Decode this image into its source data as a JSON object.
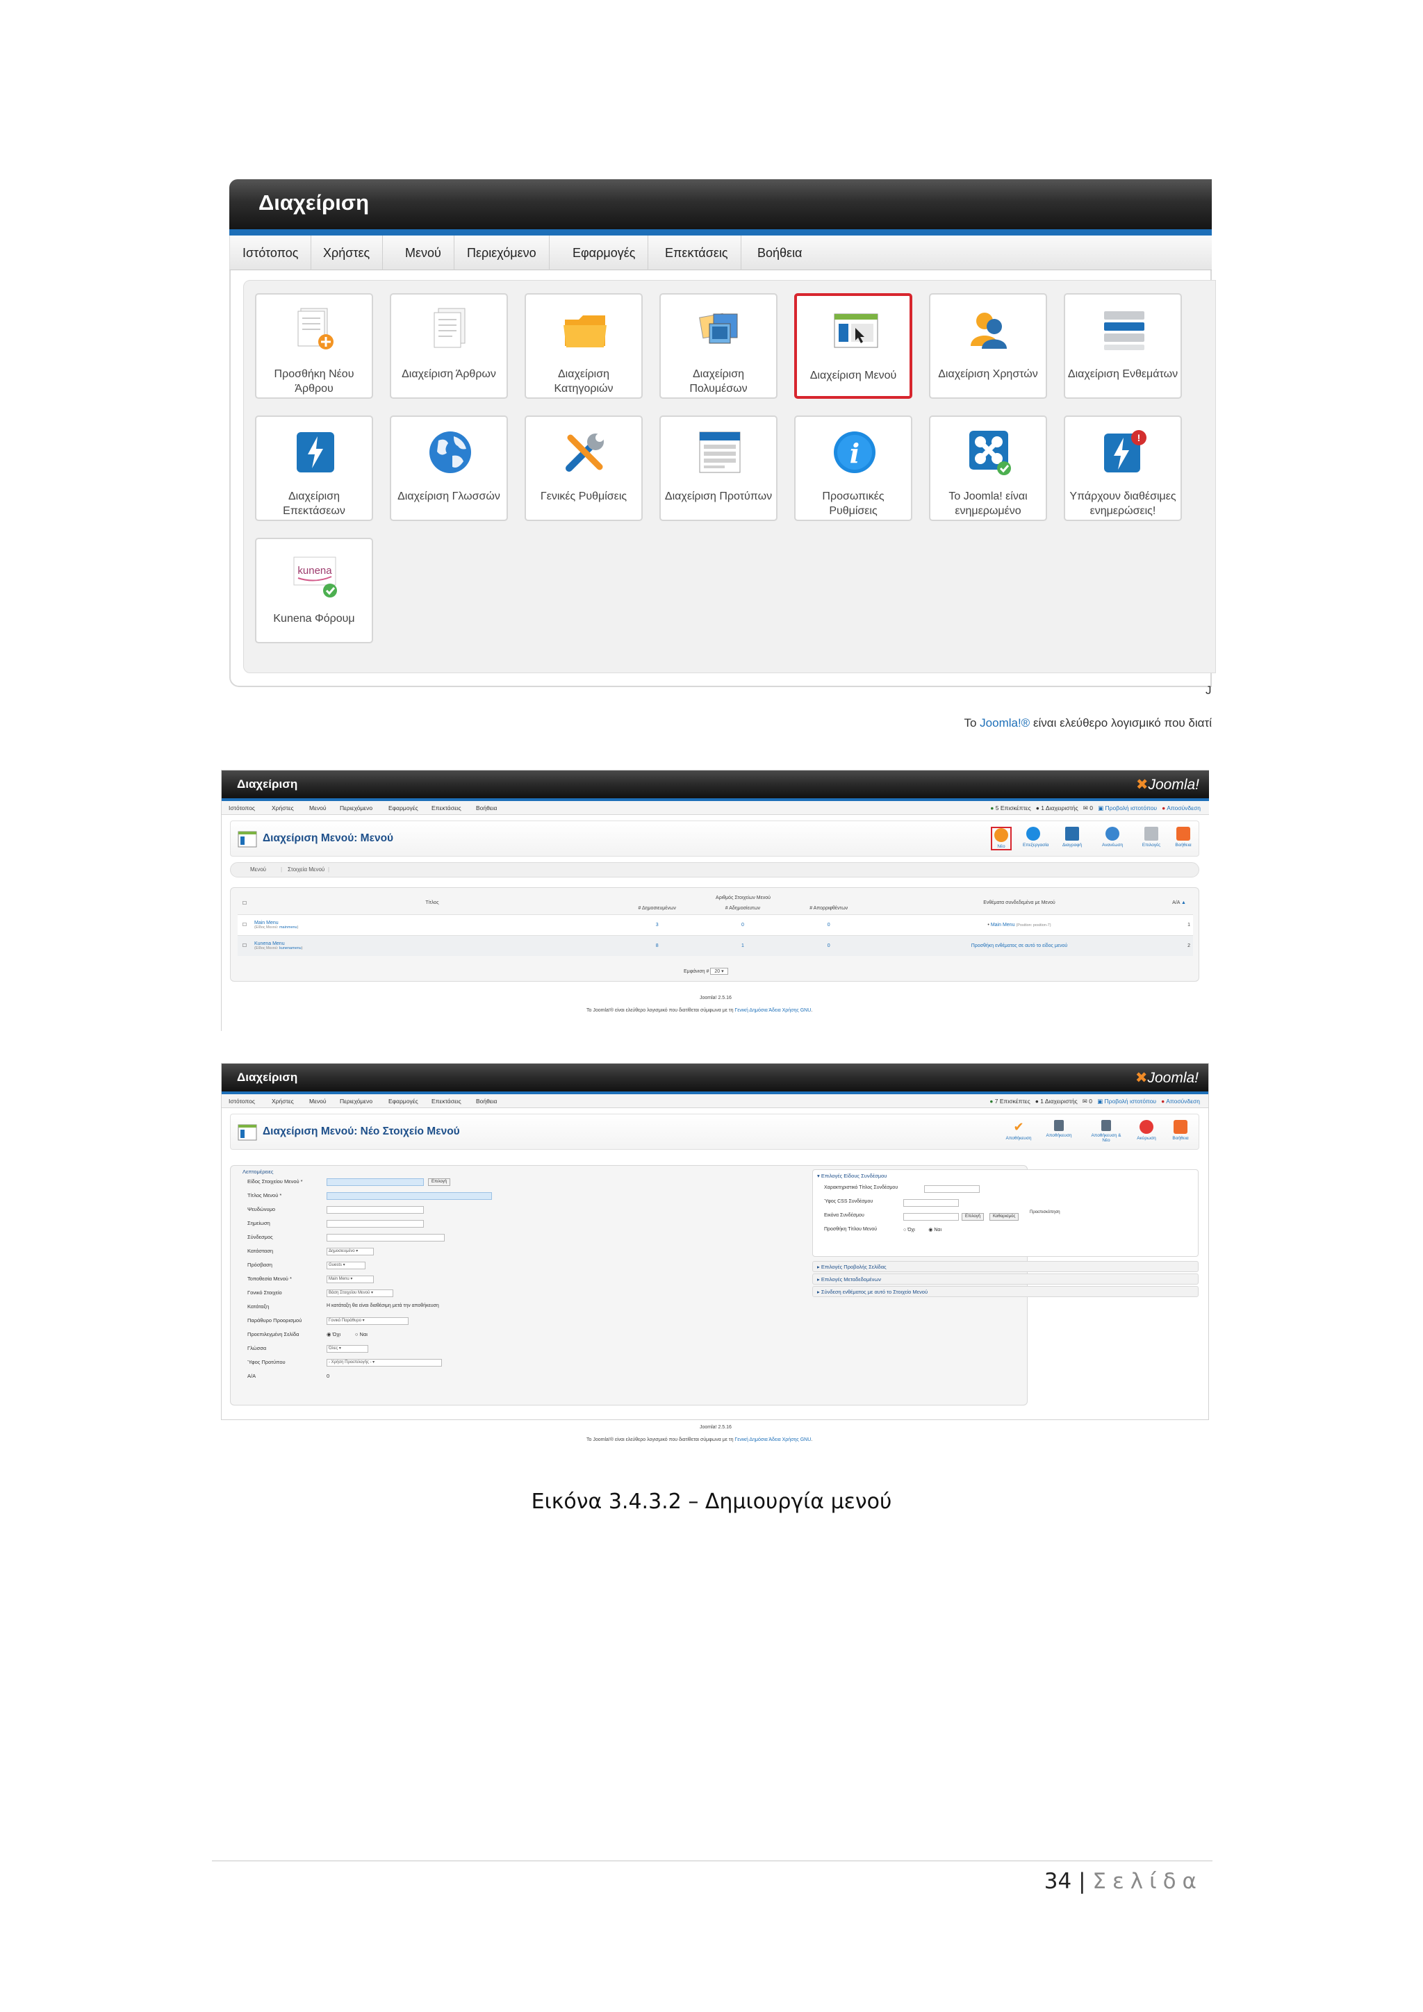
{
  "shot1": {
    "header_title": "Διαχείριση",
    "menu": [
      "Ιστότοπος",
      "Χρήστες",
      "Μενού",
      "Περιεχόμενο",
      "Εφαρμογές",
      "Επεκτάσεις",
      "Βοήθεια"
    ],
    "icons": [
      {
        "label": "Προσθήκη Νέου\nΆρθρου",
        "icon": "add-article-icon"
      },
      {
        "label": "Διαχείριση Άρθρων",
        "icon": "articles-icon"
      },
      {
        "label": "Διαχείριση\nΚατηγοριών",
        "icon": "folder-icon"
      },
      {
        "label": "Διαχείριση\nΠολυμέσων",
        "icon": "media-icon"
      },
      {
        "label": "Διαχείριση Μενού",
        "icon": "menu-icon",
        "highlighted": true
      },
      {
        "label": "Διαχείριση Χρηστών",
        "icon": "users-icon"
      },
      {
        "label": "Διαχείριση Ενθεμάτων",
        "icon": "modules-icon"
      },
      {
        "label": "Διαχείριση\nΕπεκτάσεων",
        "icon": "extensions-icon"
      },
      {
        "label": "Διαχείριση Γλωσσών",
        "icon": "globe-icon"
      },
      {
        "label": "Γενικές Ρυθμίσεις",
        "icon": "tools-icon"
      },
      {
        "label": "Διαχείριση Προτύπων",
        "icon": "template-icon"
      },
      {
        "label": "Προσωπικές\nΡυθμίσεις",
        "icon": "info-icon"
      },
      {
        "label": "To Joomla! είναι\nενημερωμένο",
        "icon": "joomla-check-icon"
      },
      {
        "label": "Υπάρχουν διαθέσιμες\nενημερώσεις!",
        "icon": "update-alert-icon"
      },
      {
        "label": "Kunena Φόρουμ",
        "icon": "kunena-icon"
      }
    ],
    "footer_j": "J",
    "footer_prefix": "Το ",
    "footer_link": "Joomla!®",
    "footer_suffix": " είναι ελεύθερο λογισμικό που διατί"
  },
  "shot2": {
    "header_title": "Διαχείριση",
    "logo": "Joomla!",
    "menu": [
      "Ιστότοπος",
      "Χρήστες",
      "Μενού",
      "Περιεχόμενο",
      "Εφαρμογές",
      "Επεκτάσεις",
      "Βοήθεια"
    ],
    "status": {
      "visitors": "5 Επισκέπτες",
      "admins": "1 Διαχειριστής",
      "messages": "0",
      "view_site": "Προβολή ιστοτόπου",
      "logout": "Αποσύνδεση"
    },
    "page_title": "Διαχείριση Μενού: Μενού",
    "toolbar": [
      "Νέο",
      "Επεξεργασία",
      "Διαγραφή",
      "Ανανέωση",
      "Επιλογές",
      "Βοήθεια"
    ],
    "subnav": [
      "Μενού",
      "Στοιχεία Μενού"
    ],
    "table": {
      "col_title": "Τίτλος",
      "col_group": "Αριθμός Στοιχείων Μενού",
      "col_published": "# Δημοσιευμένων",
      "col_unpublished": "# Αδημοσίευτων",
      "col_trashed": "# Απορριφθέντων",
      "col_modules": "Ενθέματα συνδεδεμένα με Μενού",
      "col_id": "Α/Α",
      "rows": [
        {
          "title": "Main Menu",
          "type_label": "(Είδος Μενού: ",
          "type": "mainmenu",
          "published": "3",
          "unpublished": "0",
          "trashed": "0",
          "module": "Main Menu",
          "module_note": "(Position: position-7)",
          "id": "1"
        },
        {
          "title": "Kunena Menu",
          "type_label": "(Είδος Μενού: ",
          "type": "kunenamenu",
          "published": "8",
          "unpublished": "1",
          "trashed": "0",
          "module": "Προσθήκη ενθέματος σε αυτό το είδος μενού",
          "module_note": "",
          "id": "2"
        }
      ]
    },
    "pager": "Εμφάνιση #",
    "pager_value": "20",
    "version": "Joomla! 2.5.16",
    "footer_prefix": "Το Joomla!® είναι ελεύθερο λογισμικό που διατίθεται σύμφωνα με τη ",
    "footer_link": "Γενική Δημόσια Άδεια Χρήσης GNU",
    "footer_suffix": "."
  },
  "shot3": {
    "header_title": "Διαχείριση",
    "logo": "Joomla!",
    "menu": [
      "Ιστότοπος",
      "Χρήστες",
      "Μενού",
      "Περιεχόμενο",
      "Εφαρμογές",
      "Επεκτάσεις",
      "Βοήθεια"
    ],
    "status": {
      "visitors": "7 Επισκέπτες",
      "admins": "1 Διαχειριστής",
      "messages": "0",
      "view_site": "Προβολή ιστοτόπου",
      "logout": "Αποσύνδεση"
    },
    "page_title": "Διαχείριση Μενού: Νέο Στοιχείο Μενού",
    "toolbar": [
      "Αποθήκευση",
      "Αποθήκευση",
      "Αποθήκευση & Νέο",
      "Ακύρωση",
      "Βοήθεια"
    ],
    "details_legend": "Λεπτομέρειες",
    "fields": [
      {
        "label": "Είδος Στοιχείου Μενού *",
        "value": ""
      },
      {
        "label": "Τίτλος Μενού *",
        "value": ""
      },
      {
        "label": "Ψευδώνυμο",
        "value": ""
      },
      {
        "label": "Σημείωση",
        "value": ""
      },
      {
        "label": "Σύνδεσμος",
        "value": ""
      },
      {
        "label": "Κατάσταση",
        "value": "Δημοσιευμένο"
      },
      {
        "label": "Πρόσβαση",
        "value": "Guests"
      },
      {
        "label": "Τοποθεσία Μενού *",
        "value": "Main Menu"
      },
      {
        "label": "Γονικό Στοιχείο",
        "value": "Βάση Στοιχείου Μενού"
      },
      {
        "label": "Κατάταξη",
        "value": "Η κατάταξη θα είναι διαθέσιμη μετά την αποθήκευση"
      },
      {
        "label": "Παράθυρο Προορισμού",
        "value": "Γονικό Παράθυρο"
      },
      {
        "label": "Προεπιλεγμένη Σελίδα",
        "value": ""
      },
      {
        "label": "Γλώσσα",
        "value": "Όλες"
      },
      {
        "label": "Ύφος Προτύπου",
        "value": "- Χρήση Προεπιλογής -"
      },
      {
        "label": "Α/Α",
        "value": "0"
      }
    ],
    "select_button": "Επιλογή",
    "radio_no": "Όχι",
    "radio_yes": "Ναι",
    "right_sections": {
      "link_type": "Επιλογές Είδους Συνδέσμου",
      "link_fields": [
        "Χαρακτηριστικό Τίτλος Συνδέσμου",
        "Ύφος CSS Συνδέσμου",
        "Εικόνα Συνδέσμου",
        "Προσθήκη Τίτλου Μενού"
      ],
      "link_buttons": [
        "Επιλογή",
        "Καθαρισμός"
      ],
      "preview": "Προεπισκόπηση",
      "page_display": "Επιλογές Προβολής Σελίδας",
      "metadata": "Επιλογές Μεταδεδομένων",
      "module_assign": "Σύνδεση ενθέματος με αυτό το Στοιχείο Μενού"
    },
    "version": "Joomla! 2.5.16",
    "footer_prefix": "Το Joomla!® είναι ελεύθερο λογισμικό που διατίθεται σύμφωνα με τη ",
    "footer_link": "Γενική Δημόσια Άδεια Χρήσης GNU",
    "footer_suffix": "."
  },
  "caption": "Εικόνα 3.4.3.2 – Δημιουργία μενού",
  "page_number": "34",
  "page_separator": "|",
  "page_word": "Σελίδα"
}
